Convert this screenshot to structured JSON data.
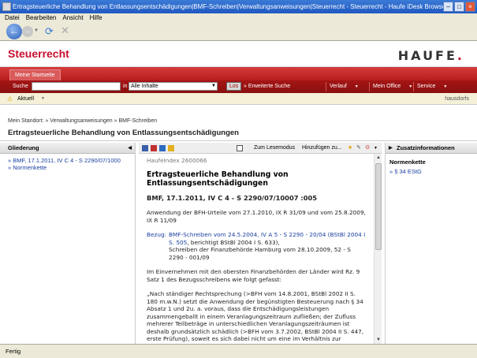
{
  "window": {
    "title": "Ertragsteuerliche Behandlung von Entlassungsentschädigungen|BMF-Schreiben|Verwaltungsanweisungen|Steuerrecht - Steuerrecht - Haufe iDesk Browser"
  },
  "menubar": {
    "items": [
      "Datei",
      "Bearbeiten",
      "Ansicht",
      "Hilfe"
    ]
  },
  "brand": {
    "title": "Steuerrecht",
    "logo": "HAUFE",
    "logo_dot": "."
  },
  "tabs": {
    "active": "Meine Startseite"
  },
  "search": {
    "label": "Suche",
    "in_label": "in",
    "scope": "Alle Inhalte",
    "go": "Los",
    "advanced": "» Erweiterte Suche",
    "menus": [
      "Verlauf",
      "Mein Office",
      "Service"
    ]
  },
  "infobar": {
    "aktuell": "Aktuell",
    "user": "hausdorfs"
  },
  "breadcrumb": {
    "text": "Mein Standort:  »  Verwaltungsanweisungen  »  BMF-Schreiben"
  },
  "page": {
    "title": "Ertragsteuerliche Behandlung von Entlassungsentschädigungen"
  },
  "left_panel": {
    "title": "Gliederung",
    "items": [
      "» BMF, 17.1.2011, IV C 4 - S 2290/07/1000",
      "» Normenkette"
    ]
  },
  "doc_toolbar": {
    "lesemodus": "Zum Lesemodus",
    "hinzufuegen": "Hinzufügen zu..."
  },
  "document": {
    "index": "HaufeIndex 2600066",
    "title": "Ertragsteuerliche Behandlung von Entlassungsentschädigungen",
    "subtitle": "BMF, 17.1.2011, IV C 4 - S 2290/07/10007 :005",
    "p1": "Anwendung der BFH-Urteile vom 27.1.2010, IX R 31/09 und vom 25.8.2009, IX R 11/09",
    "bezug_label": "Bezug:",
    "bezug_link": "BMF-Schreiben vom 24.5.2004, IV A 5 - S 2290 - 20/04 (BStBl 2004 I S. 505",
    "bezug_rest": ", berichtigt BStBl 2004 I S. 633),",
    "bezug_line2": "Schreiben der Finanzbehörde Hamburg vom 28.10.2009, 52 - S 2290 - 001/09",
    "p2": "Im Einvernehmen mit den obersten Finanzbehörden der Länder wird Rz. 9 Satz 1 des Bezugsschreibens wie folgt gefasst:",
    "p3": "„Nach ständiger Rechtsprechung (>BFH vom 14.8.2001, BStBl 2002 II S. 180 m.w.N.) setzt die Anwendung der begünstigten Besteuerung nach § 34 Absatz 1 und 2u. a. voraus, dass die Entschädigungsleistungen zusammengeballt in einem Veranlagungszeitraum zufließen; der Zufluss mehrerer Teilbeträge in unterschiedlichen Veranlagungszeiträumen ist deshalb grundsätzlich schädlich (>BFH vom 3.7.2002, BStBl 2004 II S. 447, erste Prüfung), soweit es sich dabei nicht um eine im Verhältnis zur Hauptleistung"
  },
  "right_panel": {
    "title": "Zusatzinformationen",
    "section": "Normenkette",
    "link": "» § 34 EStG"
  },
  "status": {
    "text": "Fertig"
  }
}
